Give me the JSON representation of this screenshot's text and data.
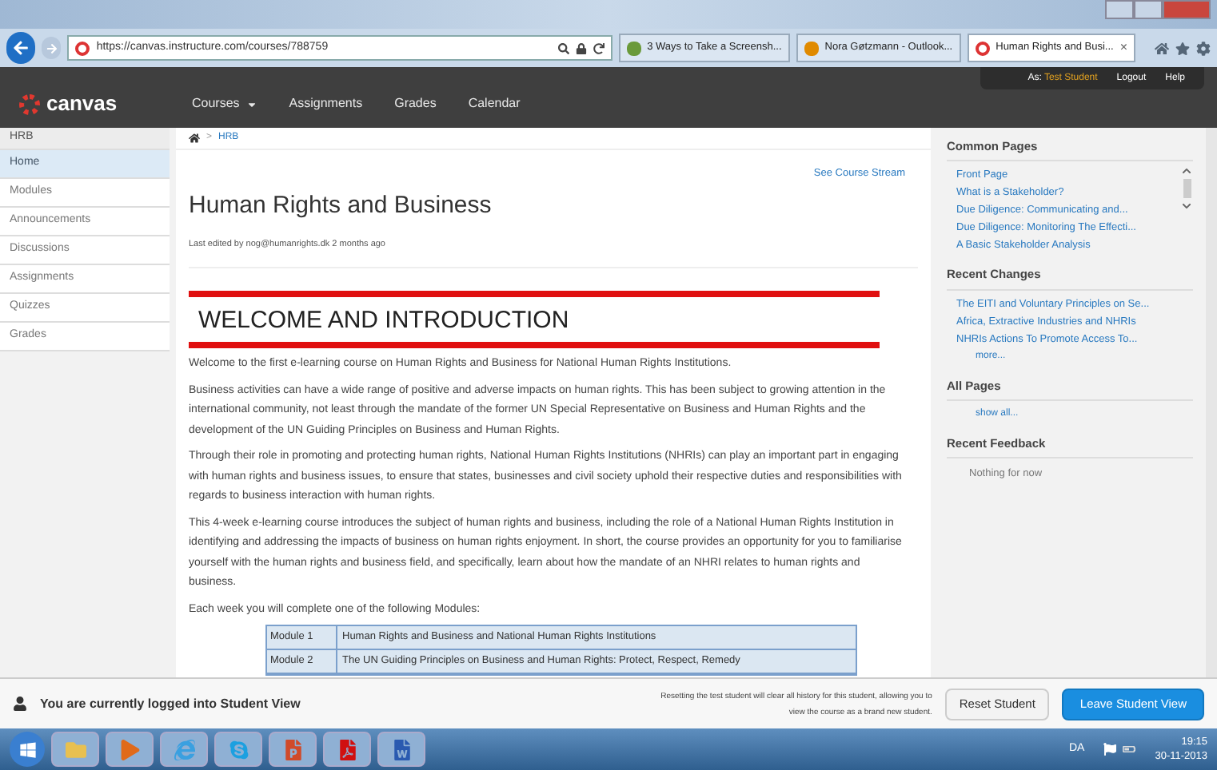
{
  "browser": {
    "url": "https://canvas.instructure.com/courses/788759",
    "tabs": [
      {
        "title": "3 Ways to Take a Screensh...",
        "kind": "doc",
        "selected": false
      },
      {
        "title": "Nora Gøtzmann - Outlook...",
        "kind": "mail",
        "selected": false
      },
      {
        "title": "Human Rights and Busi...",
        "kind": "canvas",
        "selected": true,
        "close": "×"
      }
    ]
  },
  "header": {
    "logo": "canvas",
    "user_prefix": "As:",
    "user": "Test Student",
    "links": [
      "Logout",
      "Help"
    ],
    "nav": [
      {
        "label": "Courses",
        "dropdown": true
      },
      {
        "label": "Assignments",
        "dropdown": false
      },
      {
        "label": "Grades",
        "dropdown": false
      },
      {
        "label": "Calendar",
        "dropdown": false
      }
    ]
  },
  "sidebar": {
    "title": "HRB",
    "items": [
      {
        "label": "Home",
        "selected": true
      },
      {
        "label": "Modules",
        "selected": false
      },
      {
        "label": "Announcements",
        "selected": false
      },
      {
        "label": "Discussions",
        "selected": false
      },
      {
        "label": "Assignments",
        "selected": false
      },
      {
        "label": "Quizzes",
        "selected": false
      },
      {
        "label": "Grades",
        "selected": false
      }
    ]
  },
  "breadcrumb": {
    "separator": ">",
    "items": [
      "HRB"
    ]
  },
  "page": {
    "title": "Human Rights and Business",
    "stream_link": "See Course Stream",
    "edited": "Last edited by nog@humanrights.dk 2 months ago",
    "heading": "WELCOME AND INTRODUCTION",
    "paragraphs": [
      "Welcome to the first e-learning course on Human Rights and Business for National Human Rights Institutions.",
      "Business activities can have a wide range of positive and adverse impacts on human rights. This has been subject to growing attention in the international community, not least through the mandate of the former UN Special Representative on Business and Human Rights and the development of the UN Guiding Principles on Business and Human Rights.",
      "Through their role in promoting and protecting human rights, National Human Rights Institutions (NHRIs) can play an important part in engaging with human rights and business issues, to ensure that states, businesses and civil society uphold their respective duties and responsibilities with regards to business interaction with human rights.",
      "This 4-week e-learning course introduces the subject of human rights and business, including the role of a National Human Rights Institution in identifying and addressing the impacts of business on human rights enjoyment. In short, the course provides an opportunity for you to familiarise yourself with the human rights and business field, and specifically, learn about how the mandate of an NHRI relates to human rights and business.",
      "Each week you will complete one of the following Modules:"
    ],
    "modules": [
      {
        "number": "Module 1",
        "title": "Human Rights and Business and National Human Rights Institutions"
      },
      {
        "number": "Module 2",
        "title": "The UN Guiding Principles on Business and Human Rights: Protect, Respect, Remedy"
      }
    ]
  },
  "right": {
    "sections": [
      {
        "title": "Common Pages",
        "links": [
          "Front Page",
          "What is a Stakeholder?",
          "Due Diligence: Communicating and...",
          "Due Diligence: Monitoring The Effecti...",
          "A Basic Stakeholder Analysis"
        ],
        "scroll": true
      },
      {
        "title": "Recent Changes",
        "links": [
          "The EITI and Voluntary Principles on Se...",
          "Africa, Extractive Industries and NHRIs",
          "NHRIs Actions To Promote Access To..."
        ],
        "more": "more..."
      },
      {
        "title": "All Pages",
        "more": "show all..."
      },
      {
        "title": "Recent Feedback",
        "note": "Nothing for now"
      }
    ]
  },
  "student_bar": {
    "message": "You are currently logged into Student View",
    "notice": "Resetting the test student will clear all history for this student, allowing you to view the course as a brand new student.",
    "reset": "Reset Student",
    "leave": "Leave Student View"
  },
  "taskbar": {
    "lang": "DA",
    "time": "19:15",
    "date": "30-11-2013"
  }
}
